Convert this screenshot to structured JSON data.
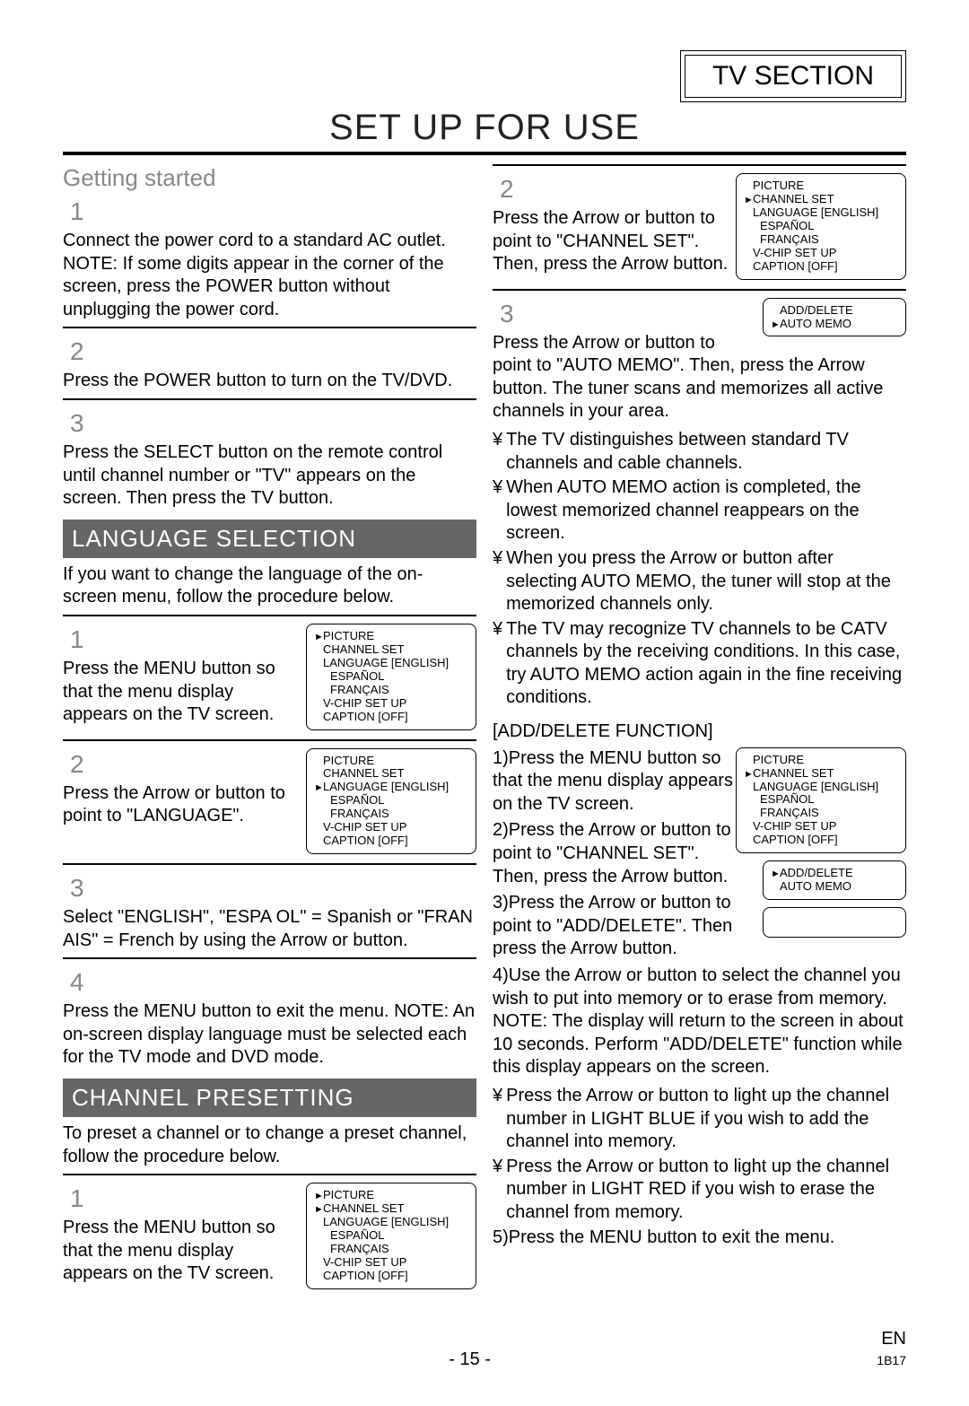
{
  "header": {
    "section_label": "TV SECTION"
  },
  "main_title": "SET UP FOR USE",
  "left": {
    "getting_started": "Getting started",
    "g1_num": "1",
    "g1_body": "Connect the power cord to a standard AC outlet. NOTE: If some digits appear in the corner of the screen, press the POWER button without unplugging the power cord.",
    "g2_num": "2",
    "g2_body": "Press the POWER button to turn on the TV/DVD.",
    "g3_num": "3",
    "g3_body": "Press the SELECT button on the remote control until channel number or \"TV\" appears on the screen. Then press the TV button.",
    "lang_banner": "LANGUAGE SELECTION",
    "lang_intro": "If you want to change the language of the on-screen menu, follow the procedure below.",
    "l1_num": "1",
    "l1_body": "Press the MENU button so that the menu display appears on the TV screen.",
    "l2_num": "2",
    "l2_body": "Press the Arrow   or    button to point to \"LANGUAGE\".",
    "l3_num": "3",
    "l3_body": "Select \"ENGLISH\", \"ESPA OL\" = Spanish or \"FRAN AIS\" = French by using the Arrow   or    button.",
    "l4_num": "4",
    "l4_body": "Press the MENU button to exit the menu. NOTE: An on-screen display language must be selected each for the TV mode and DVD mode.",
    "chan_banner": "CHANNEL PRESETTING",
    "chan_intro": "To preset a channel or to change a preset channel, follow the procedure below.",
    "c1_num": "1",
    "c1_body": "Press the MENU button so that the menu display appears on the TV screen."
  },
  "right": {
    "r2_num": "2",
    "r2_body": "Press the Arrow   or    button to point to \"CHANNEL SET\". Then, press the Arrow   button.",
    "r3_num": "3",
    "r3_body": "Press the Arrow   or    button to point to \"AUTO MEMO\". Then, press the Arrow   button. The tuner scans and memorizes all active channels in your area.",
    "b1": "The TV distinguishes between standard TV channels and cable channels.",
    "b2": "When AUTO MEMO action is completed, the lowest memorized channel reappears on the screen.",
    "b3": "When you press the Arrow   or    button after selecting AUTO MEMO, the tuner will stop at the memorized channels only.",
    "b4": "The TV may recognize TV channels to be CATV channels by the receiving conditions. In this case, try AUTO MEMO action again in the fine receiving conditions.",
    "addel_heading": "[ADD/DELETE FUNCTION]",
    "a1": "1)Press the MENU button so that the menu display appears on the TV screen.",
    "a2": "2)Press the Arrow   or    button to point to \"CHANNEL SET\". Then, press the Arrow   button.",
    "a3": "3)Press the Arrow   or    button to point to \"ADD/DELETE\". Then press the Arrow   button.",
    "a4": "4)Use the Arrow   or    button to select the channel you wish to put into memory or to erase from memory. NOTE: The display will return to the screen in about 10 seconds. Perform \"ADD/DELETE\" function while this display appears on the screen.",
    "ab1": "Press the Arrow    or     button to light up the channel number in LIGHT BLUE if you wish to add the channel into memory.",
    "ab2": "Press the Arrow    or     button to light up the channel number in LIGHT RED if you wish to erase the channel from memory.",
    "a5": "5)Press the MENU button to exit the menu."
  },
  "menus": {
    "picture": "PICTURE",
    "channel_set": "CHANNEL SET",
    "language_en": "LANGUAGE [ENGLISH]",
    "espanol": "ESPAÑOL",
    "francais": "FRANÇAIS",
    "vchip": "V-CHIP SET UP",
    "caption_off": "CAPTION [OFF]",
    "add_delete": "ADD/DELETE",
    "auto_memo": "AUTO MEMO"
  },
  "footer": {
    "page": "- 15 -",
    "lang": "EN",
    "code": "1B17"
  }
}
